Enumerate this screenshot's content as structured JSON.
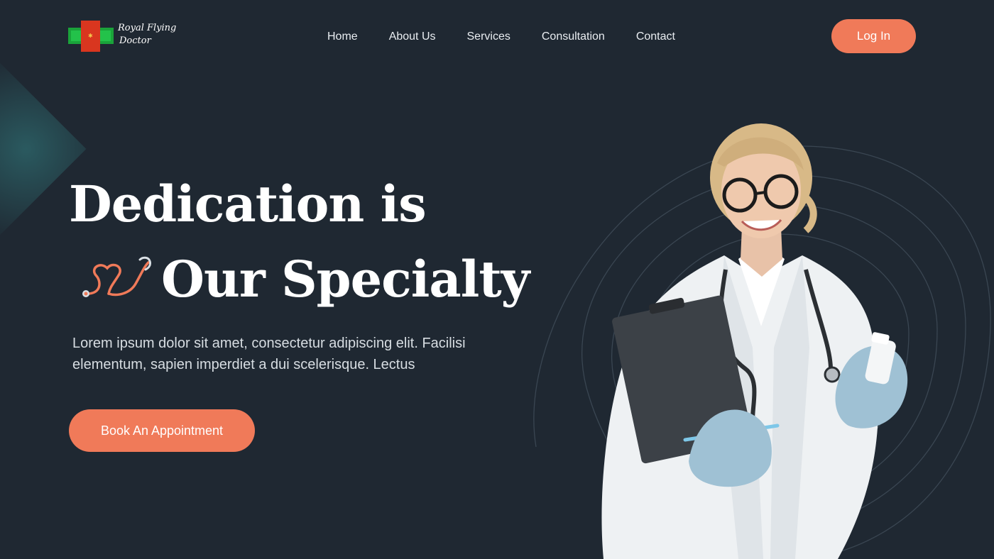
{
  "brand": {
    "name_line1": "Royal Flying",
    "name_line2": "Doctor"
  },
  "nav": {
    "items": [
      {
        "label": "Home"
      },
      {
        "label": "About Us"
      },
      {
        "label": "Services"
      },
      {
        "label": "Consultation"
      },
      {
        "label": "Contact"
      }
    ],
    "login_label": "Log In"
  },
  "hero": {
    "title_line1": "Dedication is",
    "title_line2": "Our Specialty",
    "description": "Lorem ipsum dolor sit amet, consectetur adipiscing elit. Facilisi elementum, sapien imperdiet a dui scelerisque. Lectus",
    "cta_label": "Book An Appointment"
  },
  "colors": {
    "background": "#1f2832",
    "accent": "#f07a59",
    "text": "#ffffff"
  },
  "icons": [
    "stethoscope-heart-icon",
    "medical-cross-logo"
  ]
}
